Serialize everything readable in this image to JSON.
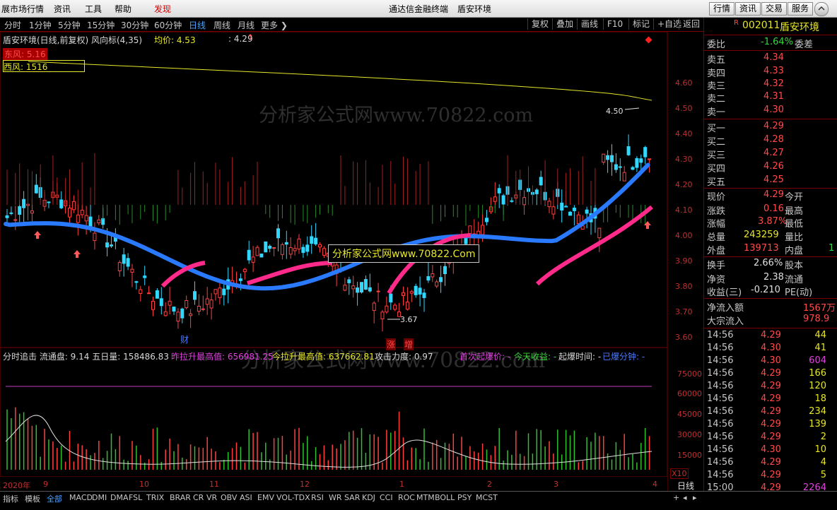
{
  "menu": {
    "items": [
      "展市场行情",
      "资讯",
      "工具",
      "帮助",
      "发现"
    ],
    "center": "通达信金融终端",
    "stock_name": "盾安环境",
    "right_buttons": [
      "行情",
      "资讯",
      "交易",
      "服务"
    ]
  },
  "tabs": {
    "periods": [
      "分时",
      "1分钟",
      "5分钟",
      "15分钟",
      "30分钟",
      "60分钟",
      "日线",
      "周线",
      "月线",
      "更多 ❯"
    ],
    "active": "日线",
    "tools": [
      "复权",
      "叠加",
      "画线",
      "F10",
      "标记",
      "+自选",
      "返回"
    ]
  },
  "main": {
    "title": "盾安环境(日线,前复权) 风向标(4,35)",
    "avg_label": "均价: 4.53",
    "price_marker": ": 4.29",
    "east_wind": "东风: 5.16",
    "west_wind": "西风: 1516",
    "high_mark": "4.50",
    "low_mark": "3.67",
    "watermark1": "分析家公式网www.70822.com",
    "watermark2": "分析家公式网www.70822.Com",
    "price_axis": [
      "4.60",
      "4.50",
      "4.40",
      "4.30",
      "4.20",
      "4.10",
      "4.00",
      "3.90",
      "3.80",
      "3.70",
      "3.60"
    ],
    "flags": [
      "财",
      "涨",
      "增"
    ]
  },
  "sub": {
    "info": [
      {
        "text": "分时追击  流通盘: 9.14  五日量: 158486.83",
        "color": "#d8d8d8"
      },
      {
        "text": "昨拉升最高值: 656981.25",
        "color": "#e040e0"
      },
      {
        "text": "今拉升最高值: 637662.81",
        "color": "#e6e62a"
      },
      {
        "text": "攻击力度: 0.97",
        "color": "#d8d8d8"
      },
      {
        "text": "首次起爆价: -",
        "color": "#e040e0"
      },
      {
        "text": "今天收益: -",
        "color": "#3cd63c"
      },
      {
        "text": "起爆时间: -",
        "color": "#d8d8d8"
      },
      {
        "text": "已爆分钟: -",
        "color": "#4a7aff"
      }
    ],
    "vol_axis": [
      "75000",
      "60000",
      "45000",
      "30000",
      "15000"
    ],
    "vol_unit": "X10"
  },
  "dates": [
    "2020年",
    "9",
    "10",
    "11",
    "12",
    "1",
    "2",
    "3",
    "4"
  ],
  "period_label": "日线",
  "bottom_tabs": [
    "指标",
    "模板",
    "全部",
    "MACD",
    "DMI",
    "DMA",
    "FSL",
    "TRIX",
    "BRAR",
    "CR",
    "VR",
    "OBV",
    "ASI",
    "EMV",
    "VOL-TDX",
    "RSI",
    "WR",
    "SAR",
    "KDJ",
    "CCI",
    "ROC",
    "MTM",
    "BOLL",
    "PSY",
    "MCST"
  ],
  "bottom_selected": "全部",
  "quote": {
    "code": "002011",
    "name": "盾安环境",
    "webi_label": "委比",
    "webi": "-1.64%",
    "wecha_label": "委差",
    "sell": [
      {
        "label": "卖五",
        "price": "4.34"
      },
      {
        "label": "卖四",
        "price": "4.33"
      },
      {
        "label": "卖三",
        "price": "4.32"
      },
      {
        "label": "卖二",
        "price": "4.31"
      },
      {
        "label": "卖一",
        "price": "4.30"
      }
    ],
    "buy": [
      {
        "label": "买一",
        "price": "4.29"
      },
      {
        "label": "买二",
        "price": "4.28"
      },
      {
        "label": "买三",
        "price": "4.27"
      },
      {
        "label": "买四",
        "price": "4.26"
      },
      {
        "label": "买五",
        "price": "4.25"
      }
    ],
    "stats": [
      {
        "l1": "现价",
        "v1": "4.29",
        "l2": "今开"
      },
      {
        "l1": "涨跌",
        "v1": "0.16",
        "l2": "最高"
      },
      {
        "l1": "涨幅",
        "v1": "3.87%",
        "l2": "最低"
      },
      {
        "l1": "总量",
        "v1": "243259",
        "l2": "量比"
      },
      {
        "l1": "外盘",
        "v1": "139713",
        "l2": "内盘",
        "v2": "1"
      }
    ],
    "stats2": [
      {
        "l1": "换手",
        "v1": "2.66%",
        "l2": "股本"
      },
      {
        "l1": "净资",
        "v1": "2.38",
        "l2": "流通"
      },
      {
        "l1": "收益(三)",
        "v1": "-0.210",
        "l2": "PE(动)"
      }
    ],
    "flow": [
      {
        "label": "净流入额",
        "value": "1567万"
      },
      {
        "label": "大宗流入",
        "value": "978.9"
      }
    ],
    "ticks": [
      {
        "t": "14:56",
        "p": "4.29",
        "v": "44"
      },
      {
        "t": "14:56",
        "p": "4.30",
        "v": "41"
      },
      {
        "t": "14:56",
        "p": "4.30",
        "v": "604"
      },
      {
        "t": "14:56",
        "p": "4.29",
        "v": "166"
      },
      {
        "t": "14:56",
        "p": "4.29",
        "v": "120"
      },
      {
        "t": "14:56",
        "p": "4.29",
        "v": "18"
      },
      {
        "t": "14:56",
        "p": "4.29",
        "v": "234"
      },
      {
        "t": "14:56",
        "p": "4.29",
        "v": "139"
      },
      {
        "t": "14:56",
        "p": "4.29",
        "v": "2"
      },
      {
        "t": "14:56",
        "p": "4.30",
        "v": "10"
      },
      {
        "t": "14:56",
        "p": "4.29",
        "v": "4"
      },
      {
        "t": "14:56",
        "p": "4.29",
        "v": "5"
      },
      {
        "t": "15:00",
        "p": "4.29",
        "v": "2264"
      }
    ]
  }
}
